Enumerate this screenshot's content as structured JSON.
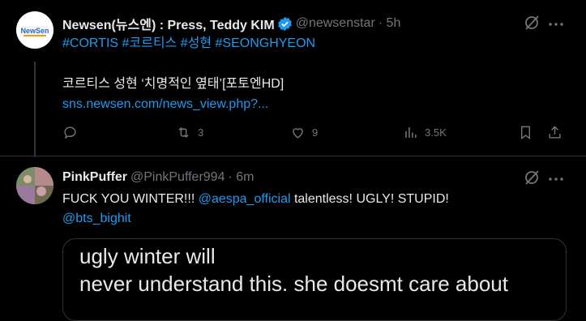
{
  "tweet1": {
    "display_name": "Newsen(뉴스엔) : Press, Teddy KIM",
    "handle": "@newsenstar",
    "time": "· 5h",
    "avatar_text": "NewSen",
    "hashtags": "#CORTIS #코르티스  #성현 #SEONGHYEON",
    "headline": "코르티스 성현 ‘치명적인 옆태’[포토엔HD]",
    "link": "sns.newsen.com/news_view.php?...",
    "actions": {
      "reply": "",
      "repost": "3",
      "like": "9",
      "views": "3.5K"
    }
  },
  "tweet2": {
    "display_name": "PinkPuffer",
    "handle": "@PinkPuffer994",
    "time": "· 6m",
    "text_part1": "FUCK YOU WINTER!!! ",
    "mention1": "@aespa_official",
    "text_part2": " talentless! UGLY! STUPID!",
    "mention2": "@bts_bighit",
    "media_line1": "ugly winter will",
    "media_line2": "never understand this. she doesmt care about"
  },
  "colors": {
    "link": "#1d9bf0",
    "muted": "#71767b",
    "verified": "#1d9bf0",
    "background": "#000000"
  },
  "icons": [
    "grok-icon",
    "more-icon",
    "reply-icon",
    "repost-icon",
    "like-icon",
    "views-icon",
    "bookmark-icon",
    "share-icon",
    "verified-icon"
  ]
}
